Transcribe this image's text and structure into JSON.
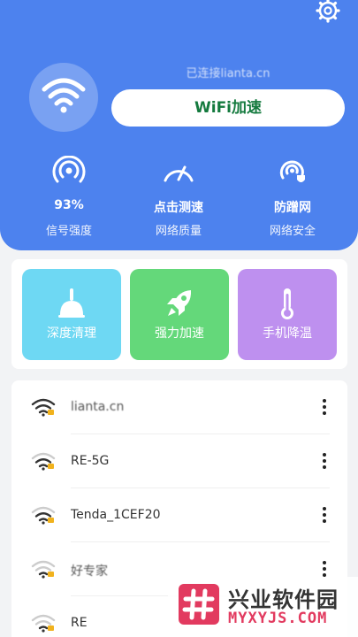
{
  "header": {
    "connected_text": "已连接lianta.cn",
    "boost_button": "WiFi加速",
    "stats": [
      {
        "value": "93%",
        "label": "信号强度",
        "icon": "signal-radar-icon"
      },
      {
        "value": "点击测速",
        "label": "网络质量",
        "icon": "speedometer-icon"
      },
      {
        "value": "防蹭网",
        "label": "网络安全",
        "icon": "shield-signal-icon"
      }
    ]
  },
  "tools": [
    {
      "label": "深度清理",
      "icon": "broom-icon",
      "color": "#6ed8f3"
    },
    {
      "label": "强力加速",
      "icon": "rocket-icon",
      "color": "#64d87a"
    },
    {
      "label": "手机降温",
      "icon": "thermometer-icon",
      "color": "#be90ef"
    }
  ],
  "wifi_list": [
    {
      "name": "lianta.cn"
    },
    {
      "name": "RE-5G"
    },
    {
      "name": "Tenda_1CEF20"
    },
    {
      "name": "好专家"
    },
    {
      "name": "RE"
    }
  ],
  "watermark": {
    "cn": "兴业软件园",
    "en": "MYXYJS.COM"
  },
  "colors": {
    "header_bg": "#4d82ee",
    "boost_text": "#147a3e",
    "page_bg": "#f2f3f5"
  }
}
